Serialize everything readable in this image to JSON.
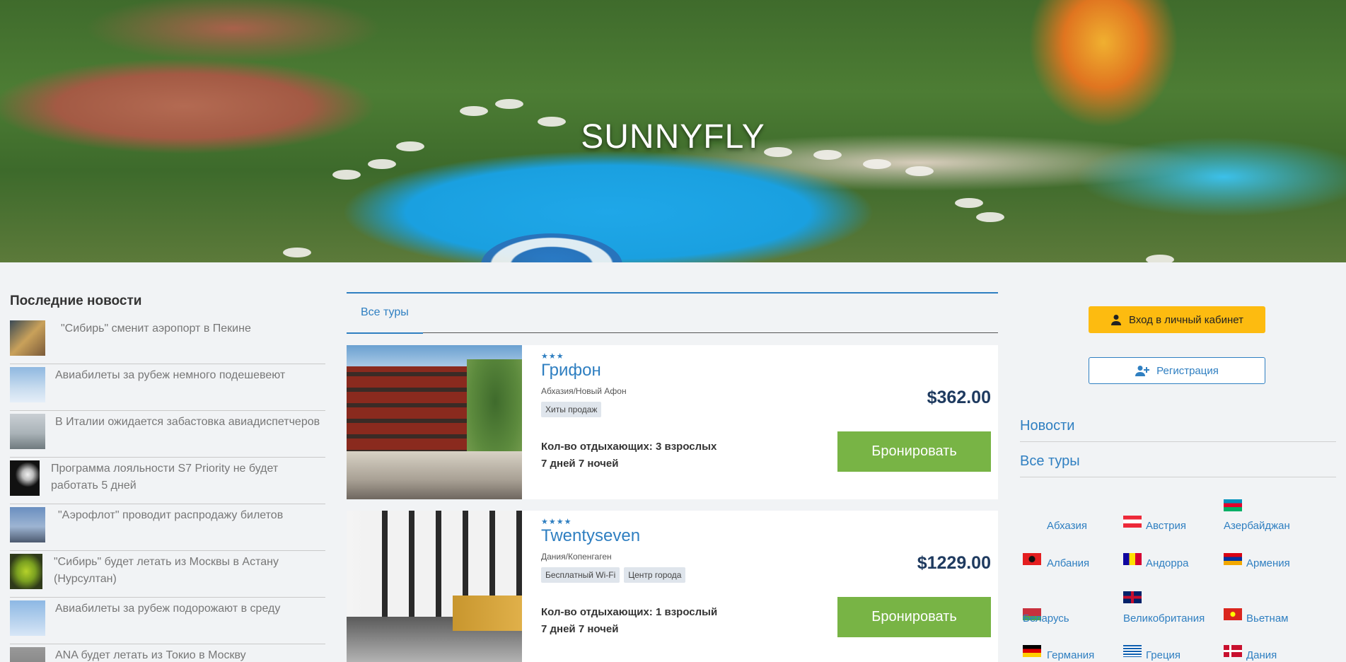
{
  "hero": {
    "title": "SUNNYFLY"
  },
  "news": {
    "heading": "Последние новости",
    "items": [
      {
        "text": "\"Сибирь\" сменит аэропорт в Пекине"
      },
      {
        "text": "Авиабилеты за рубеж немного подешевеют"
      },
      {
        "text": "В Италии ожидается забастовка авиадиспетчеров"
      },
      {
        "text": "Программа лояльности S7 Priority не будет работать 5 дней"
      },
      {
        "text": "\"Аэрофлот\" проводит распродажу билетов"
      },
      {
        "text": "\"Сибирь\" будет летать из Москвы в Астану (Нурсултан)"
      },
      {
        "text": "Авиабилеты за рубеж подорожают в среду"
      },
      {
        "text": "ANA будет летать из Токио в Москву"
      }
    ]
  },
  "tabs": {
    "all_tours": "Все туры"
  },
  "tours": [
    {
      "stars": "★★★",
      "name": "Грифон",
      "location": "Абхазия/Новый Афон",
      "tags": [
        "Хиты продаж"
      ],
      "guests": "Кол-во отдыхающих: 3 взрослых",
      "duration": "7 дней 7 ночей",
      "price": "$362.00",
      "book": "Бронировать"
    },
    {
      "stars": "★★★★",
      "name": "Twentyseven",
      "location": "Дания/Копенгаген",
      "tags": [
        "Бесплатный Wi-Fi",
        "Центр города"
      ],
      "guests": "Кол-во отдыхающих: 1 взрослый",
      "duration": "7 дней 7 ночей",
      "price": "$1229.00",
      "book": "Бронировать"
    }
  ],
  "sidebar": {
    "login": "Вход в личный кабинет",
    "register": "Регистрация",
    "links": {
      "news": "Новости",
      "all_tours": "Все туры"
    },
    "countries": [
      {
        "name": "Абхазия"
      },
      {
        "name": "Австрия"
      },
      {
        "name": "Азербайджан"
      },
      {
        "name": "Албания"
      },
      {
        "name": "Андорра"
      },
      {
        "name": "Армения"
      },
      {
        "name": "Беларусь"
      },
      {
        "name": "Великобритания"
      },
      {
        "name": "Вьетнам"
      },
      {
        "name": "Германия"
      },
      {
        "name": "Греция"
      },
      {
        "name": "Дания"
      }
    ]
  },
  "colors": {
    "accent": "#2f7fc1",
    "book": "#78b445",
    "login": "#fdbb10",
    "price": "#1e3a5f"
  }
}
